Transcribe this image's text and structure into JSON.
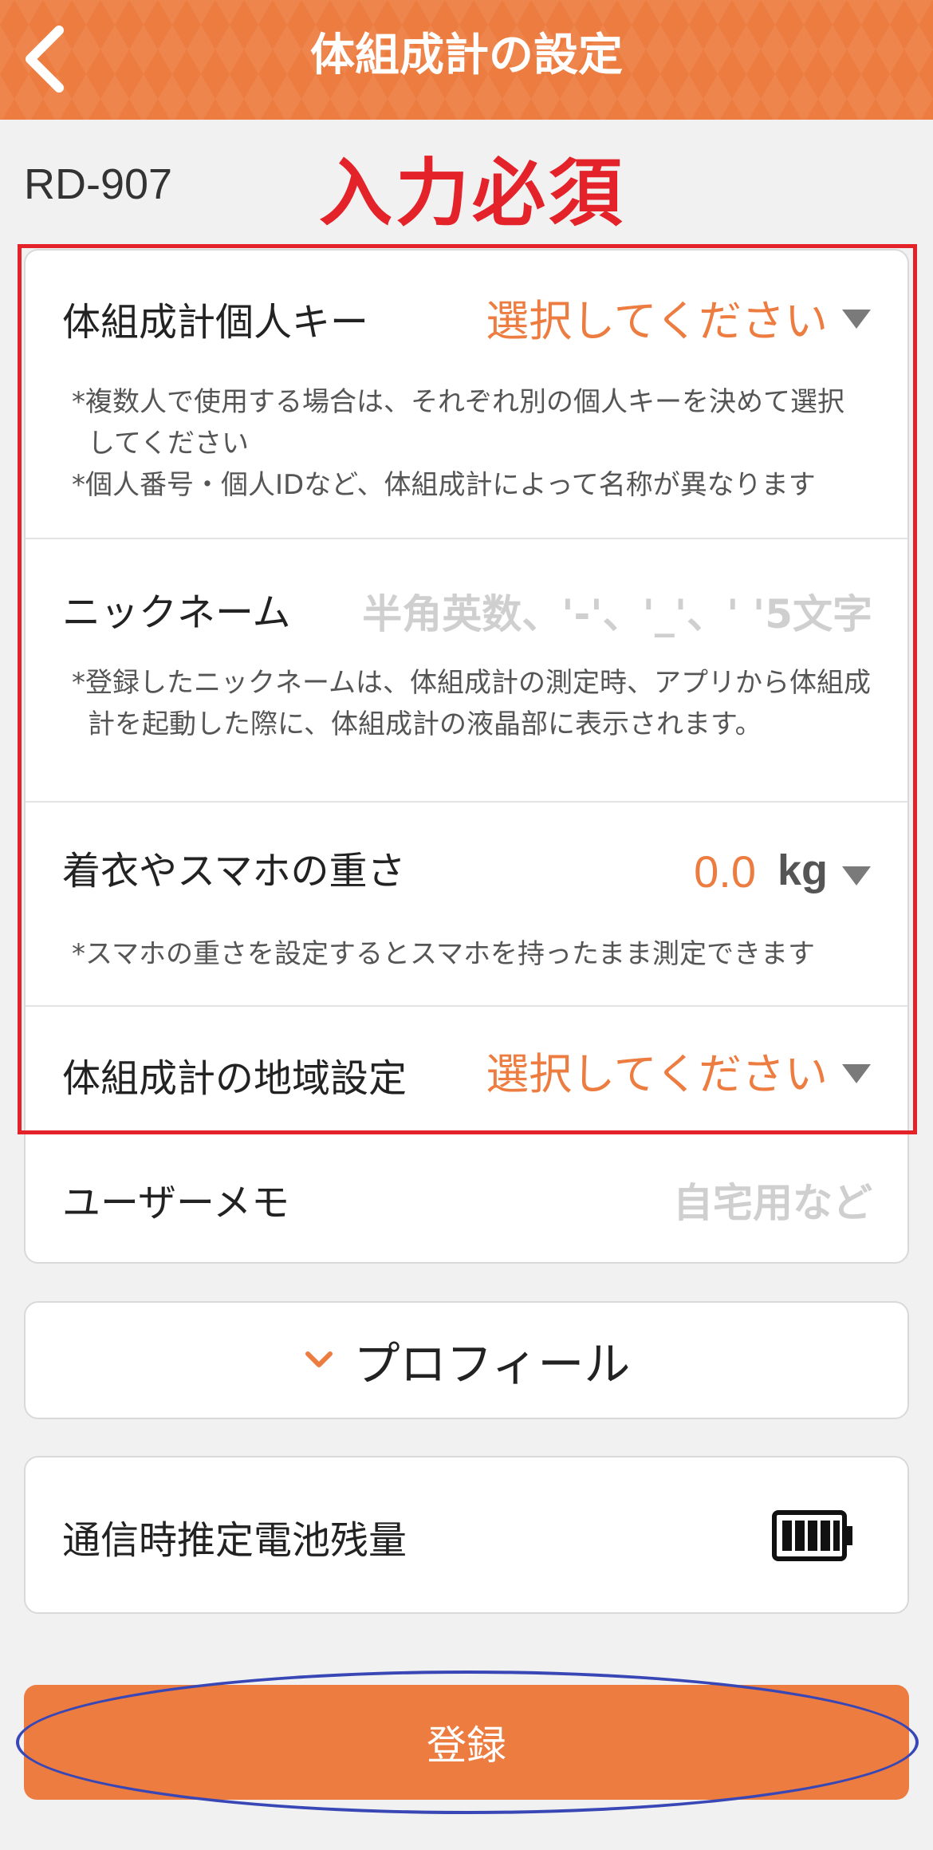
{
  "header": {
    "title": "体組成計の設定",
    "back_icon": "chevron-left-icon"
  },
  "device": {
    "model": "RD-907",
    "required_label": "入力必須"
  },
  "fields": {
    "personal_key": {
      "label": "体組成計個人キー",
      "value": "選択してください",
      "note_1": "*複数人で使用する場合は、それぞれ別の個人キーを決めて選択",
      "note_1b": "してください",
      "note_2": "*個人番号・個人IDなど、体組成計によって名称が異なります"
    },
    "nickname": {
      "label": "ニックネーム",
      "placeholder": "半角英数、'-'、'_'、' '5文字",
      "note_1": "*登録したニックネームは、体組成計の測定時、アプリから体組成",
      "note_1b": "計を起動した際に、体組成計の液晶部に表示されます。"
    },
    "clothing_weight": {
      "label": "着衣やスマホの重さ",
      "value": "0.0",
      "unit": "kg",
      "note_1": "*スマホの重さを設定するとスマホを持ったまま測定できます"
    },
    "region": {
      "label": "体組成計の地域設定",
      "value": "選択してください"
    },
    "user_memo": {
      "label": "ユーザーメモ",
      "placeholder": "自宅用など"
    }
  },
  "profile": {
    "label": "プロフィール",
    "icon": "chevron-down-icon"
  },
  "battery": {
    "label": "通信時推定電池残量",
    "level": 1.0,
    "icon": "battery-icon"
  },
  "submit": {
    "label": "登録"
  },
  "colors": {
    "accent": "#ec7c3f",
    "annotation_red": "#e3222a",
    "annotation_blue": "#3847b5"
  }
}
